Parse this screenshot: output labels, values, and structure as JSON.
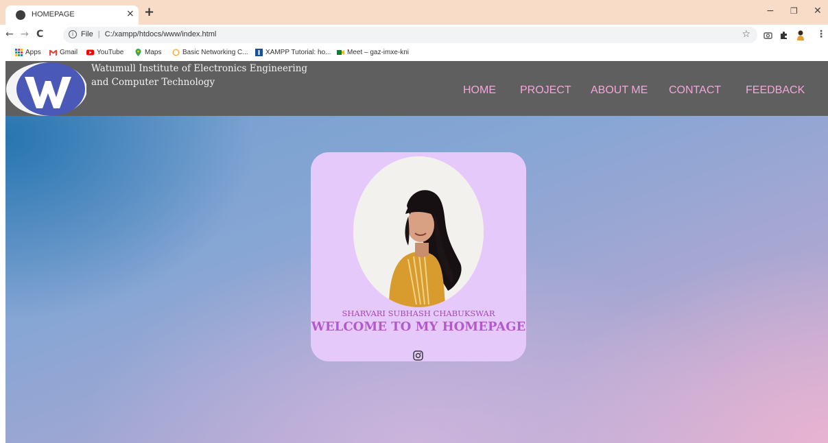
{
  "browser": {
    "tab_title": "HOMEPAGE",
    "tab_close": "×",
    "new_tab": "+",
    "url_prefix": "File",
    "url": "C:/xampp/htdocs/www/index.html",
    "window_controls": {
      "minimize": "−",
      "restore": "❐",
      "close": "✕"
    },
    "bookmarks": [
      {
        "label": "Apps",
        "icon": "apps-grid-icon"
      },
      {
        "label": "Gmail",
        "icon": "gmail-icon"
      },
      {
        "label": "YouTube",
        "icon": "youtube-icon"
      },
      {
        "label": "Maps",
        "icon": "maps-icon"
      },
      {
        "label": "Basic Networking C...",
        "icon": "circle-icon"
      },
      {
        "label": "XAMPP Tutorial: ho...",
        "icon": "xampp-icon"
      },
      {
        "label": "Meet – gaz-imxe-kni",
        "icon": "meet-icon"
      }
    ]
  },
  "site": {
    "institute_line1": "Watumull Institute of Electronics Engineering",
    "institute_line2": "and Computer Technology",
    "nav": [
      "HOME",
      "PROJECT",
      "ABOUT ME",
      "CONTACT",
      "FEEDBACK"
    ],
    "nav_color": "#f3a7d9",
    "header_bg": "#5f5f5f"
  },
  "profile": {
    "name": "SHARVARI SUBHASH CHABUKSWAR",
    "welcome": "WELCOME TO MY HOMEPAGE",
    "social_icon": "instagram-icon",
    "card_bg": "#e6c9fb",
    "text_color": "#b35ac9"
  }
}
